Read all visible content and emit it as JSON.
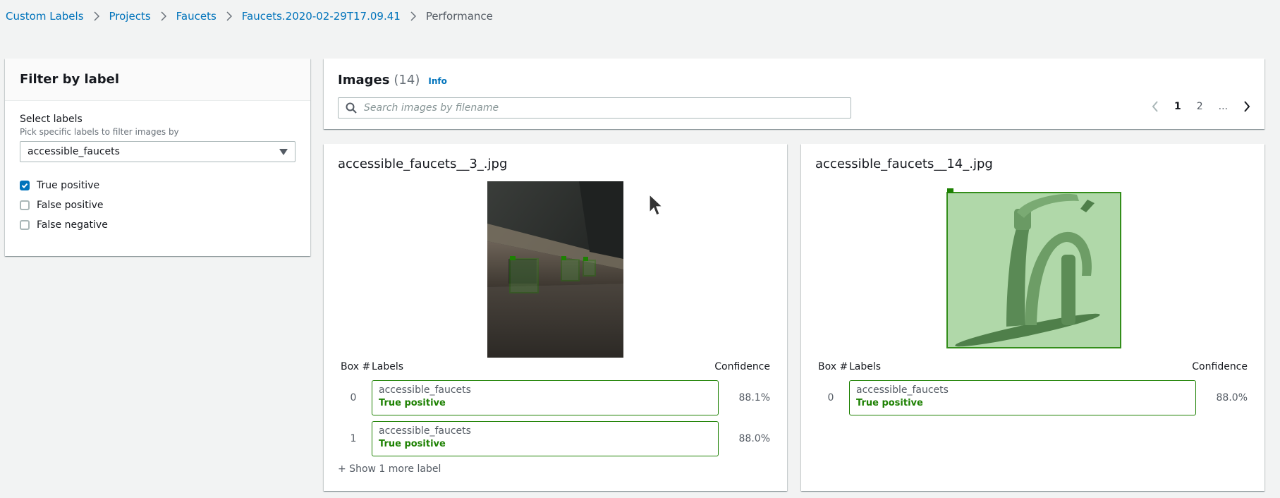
{
  "breadcrumb": {
    "items": [
      "Custom Labels",
      "Projects",
      "Faucets",
      "Faucets.2020-02-29T17.09.41"
    ],
    "current": "Performance"
  },
  "filter": {
    "title": "Filter by label",
    "select_label": "Select labels",
    "select_description": "Pick specific labels to filter images by",
    "selected_value": "accessible_faucets",
    "checkboxes": [
      {
        "label": "True positive",
        "checked": true
      },
      {
        "label": "False positive",
        "checked": false
      },
      {
        "label": "False negative",
        "checked": false
      }
    ]
  },
  "images": {
    "title": "Images",
    "count": "(14)",
    "info": "Info",
    "search_placeholder": "Search images by filename",
    "pages": [
      "1",
      "2",
      "..."
    ]
  },
  "table_headers": {
    "box": "Box #",
    "labels": "Labels",
    "confidence": "Confidence"
  },
  "cards": [
    {
      "filename": "accessible_faucets__3_.jpg",
      "rows": [
        {
          "box": "0",
          "label": "accessible_faucets",
          "status": "True positive",
          "confidence": "88.1%"
        },
        {
          "box": "1",
          "label": "accessible_faucets",
          "status": "True positive",
          "confidence": "88.0%"
        }
      ],
      "show_more": "+ Show 1 more label"
    },
    {
      "filename": "accessible_faucets__14_.jpg",
      "rows": [
        {
          "box": "0",
          "label": "accessible_faucets",
          "status": "True positive",
          "confidence": "88.0%"
        }
      ]
    }
  ],
  "colors": {
    "link": "#0073bb",
    "positive": "#1d8102",
    "background": "#f2f3f3"
  }
}
